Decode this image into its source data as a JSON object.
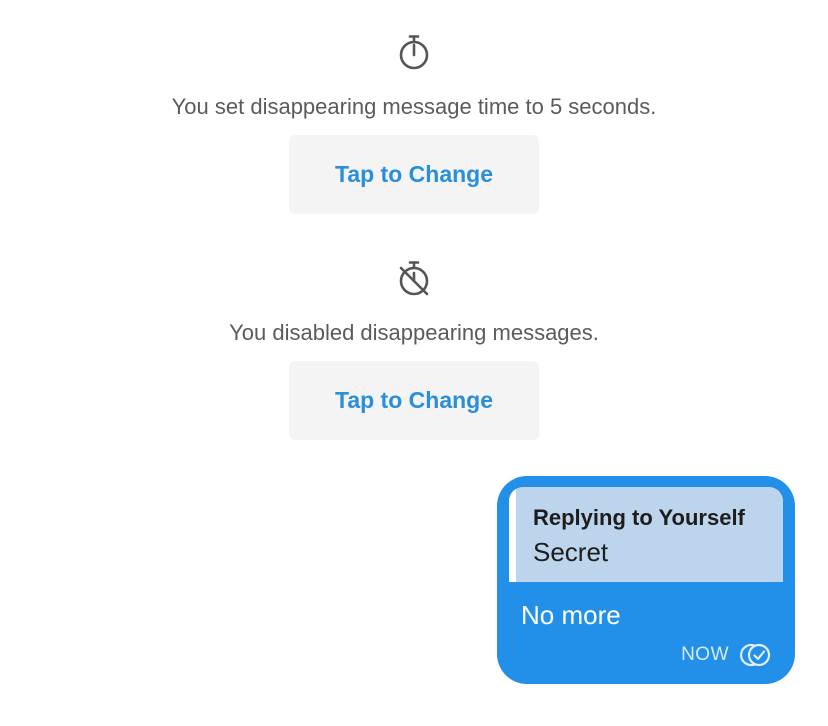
{
  "events": [
    {
      "icon": "stopwatch-icon",
      "text": "You set disappearing message time to 5 seconds.",
      "button_label": "Tap to Change"
    },
    {
      "icon": "stopwatch-off-icon",
      "text": "You disabled disappearing messages.",
      "button_label": "Tap to Change"
    }
  ],
  "message": {
    "reply_author": "Replying to Yourself",
    "reply_text": "Secret",
    "text": "No more",
    "time": "NOW",
    "status_icon": "read-receipt-icon"
  },
  "colors": {
    "accent": "#2a8fd8",
    "bubble": "#2290e9",
    "quote_bg": "#bcd5ec",
    "button_bg": "#f4f4f4",
    "event_text": "#5b5b5b"
  }
}
